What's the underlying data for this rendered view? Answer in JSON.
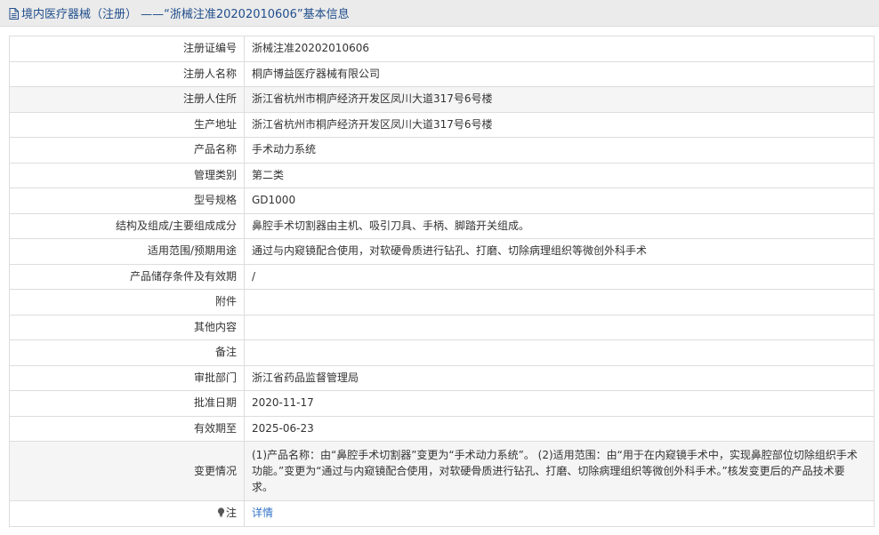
{
  "header": {
    "title": "境内医疗器械（注册） ——“浙械注准20202010606”基本信息"
  },
  "rows": [
    {
      "label": "注册证编号",
      "value": "浙械注准20202010606"
    },
    {
      "label": "注册人名称",
      "value": "桐庐博益医疗器械有限公司"
    },
    {
      "label": "注册人住所",
      "value": "浙江省杭州市桐庐经济开发区凤川大道317号6号楼"
    },
    {
      "label": "生产地址",
      "value": "浙江省杭州市桐庐经济开发区凤川大道317号6号楼"
    },
    {
      "label": "产品名称",
      "value": "手术动力系统"
    },
    {
      "label": "管理类别",
      "value": "第二类"
    },
    {
      "label": "型号规格",
      "value": "GD1000"
    },
    {
      "label": "结构及组成/主要组成成分",
      "value": "鼻腔手术切割器由主机、吸引刀具、手柄、脚踏开关组成。"
    },
    {
      "label": "适用范围/预期用途",
      "value": "通过与内窥镜配合使用，对软硬骨质进行钻孔、打磨、切除病理组织等微创外科手术"
    },
    {
      "label": "产品储存条件及有效期",
      "value": "/"
    },
    {
      "label": "附件",
      "value": ""
    },
    {
      "label": "其他内容",
      "value": ""
    },
    {
      "label": "备注",
      "value": ""
    },
    {
      "label": "审批部门",
      "value": "浙江省药品监督管理局"
    },
    {
      "label": "批准日期",
      "value": "2020-11-17"
    },
    {
      "label": "有效期至",
      "value": "2025-06-23"
    },
    {
      "label": "变更情况",
      "value": "(1)产品名称：由“鼻腔手术切割器”变更为“手术动力系统”。 (2)适用范围：由“用于在内窥镜手术中，实现鼻腔部位切除组织手术功能。”变更为“通过与内窥镜配合使用，对软硬骨质进行钻孔、打磨、切除病理组织等微创外科手术。”核发变更后的产品技术要求。"
    }
  ],
  "note": {
    "label": "注",
    "link_text": "详情"
  },
  "colors": {
    "header_bg": "#ebebeb",
    "title_text": "#1f4e8c",
    "link": "#3473c8",
    "alt_row": "#f5f5f5",
    "border": "#dddddd"
  },
  "icons": {
    "header": "document-icon",
    "note": "lightbulb-icon"
  }
}
